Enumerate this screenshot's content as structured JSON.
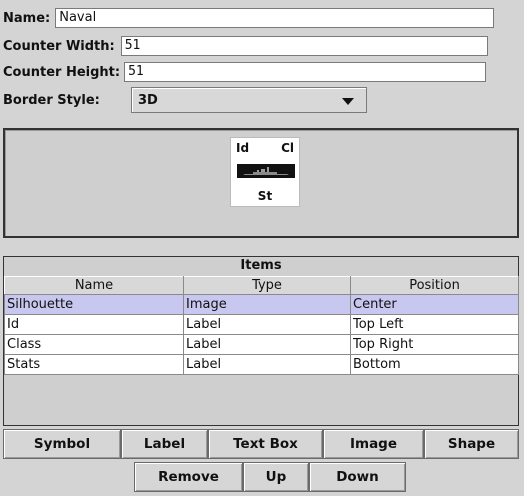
{
  "form": {
    "name_label": "Name:",
    "name_value": "Naval",
    "width_label": "Counter Width:",
    "width_value": "51",
    "height_label": "Counter Height:",
    "height_value": "51",
    "border_label": "Border Style:",
    "border_value": "3D"
  },
  "preview": {
    "top_left": "Id",
    "top_right": "Cl",
    "bottom": "St"
  },
  "items": {
    "title": "Items",
    "columns": [
      "Name",
      "Type",
      "Position"
    ],
    "rows": [
      [
        "Silhouette",
        "Image",
        "Center"
      ],
      [
        "Id",
        "Label",
        "Top Left"
      ],
      [
        "Class",
        "Label",
        "Top Right"
      ],
      [
        "Stats",
        "Label",
        "Bottom"
      ]
    ]
  },
  "buttons": {
    "symbol": "Symbol",
    "label": "Label",
    "text_box": "Text Box",
    "image": "Image",
    "shape": "Shape",
    "remove": "Remove",
    "up": "Up",
    "down": "Down"
  },
  "colors": {
    "selection": "#c7c7ef",
    "panel": "#d4d4d4"
  }
}
